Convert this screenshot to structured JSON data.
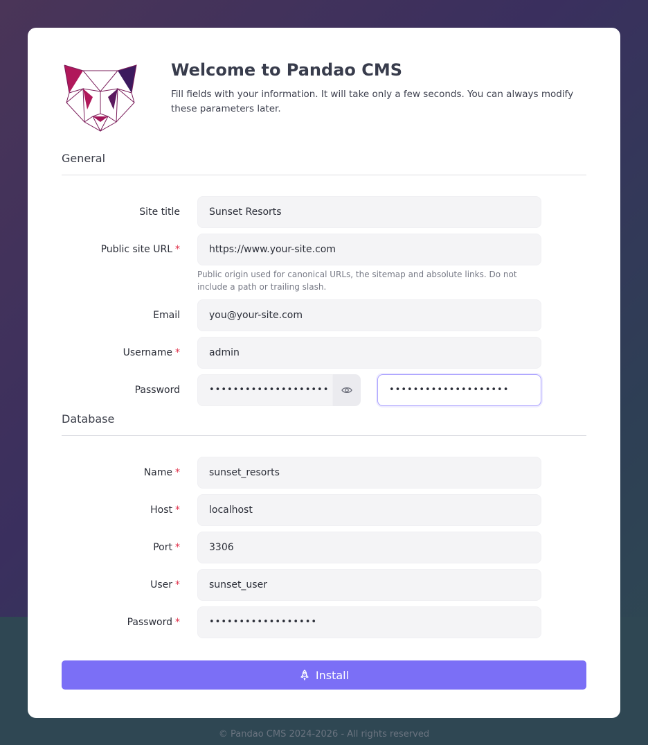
{
  "header": {
    "title": "Welcome to Pandao CMS",
    "intro": "Fill fields with your information. It will take only a few seconds. You can always modify these parameters later."
  },
  "general": {
    "section_title": "General",
    "site_title": {
      "label": "Site title",
      "value": "Sunset Resorts"
    },
    "public_url": {
      "label": "Public site URL",
      "value": "https://www.your-site.com",
      "help": "Public origin used for canonical URLs, the sitemap and absolute links. Do not include a path or trailing slash."
    },
    "email": {
      "label": "Email",
      "value": "you@your-site.com"
    },
    "username": {
      "label": "Username",
      "value": "admin"
    },
    "password": {
      "label": "Password",
      "value": "••••••••••••••••••••",
      "confirm_value": "••••••••••••••••••••"
    }
  },
  "database": {
    "section_title": "Database",
    "name": {
      "label": "Name",
      "value": "sunset_resorts"
    },
    "host": {
      "label": "Host",
      "value": "localhost"
    },
    "port": {
      "label": "Port",
      "value": "3306"
    },
    "user": {
      "label": "User",
      "value": "sunset_user"
    },
    "password": {
      "label": "Password",
      "value": "••••••••••••••••••"
    }
  },
  "required_marker": "*",
  "actions": {
    "install_label": "Install",
    "install_icon": "rocket-icon"
  },
  "footer": {
    "text": "© Pandao CMS 2024-2026 - All rights reserved"
  },
  "colors": {
    "accent": "#7b6ff6",
    "required": "#e0304a",
    "logo_primary": "#a3175a",
    "logo_secondary": "#3a1a5e"
  }
}
